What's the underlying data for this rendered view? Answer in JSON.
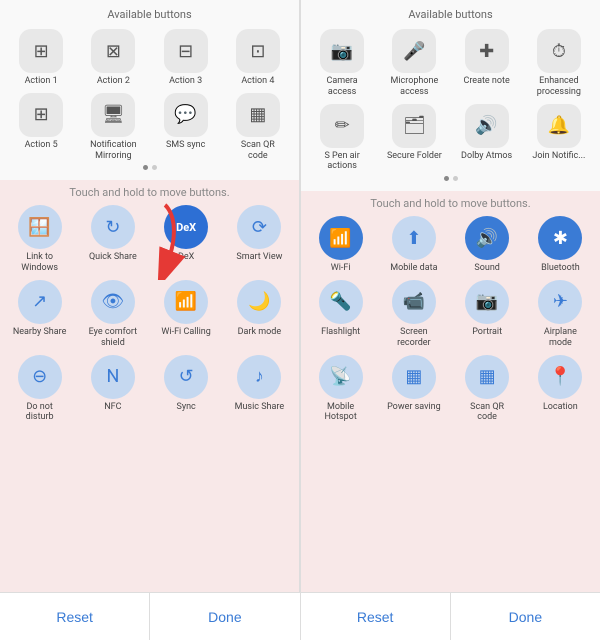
{
  "left_panel": {
    "available_title": "Available buttons",
    "available_buttons": [
      {
        "label": "Action 1",
        "icon": "⊞"
      },
      {
        "label": "Action 2",
        "icon": "⊠"
      },
      {
        "label": "Action 3",
        "icon": "⊟"
      },
      {
        "label": "Action 4",
        "icon": "⊡"
      },
      {
        "label": "Action 5",
        "icon": "⊞"
      },
      {
        "label": "Notification Mirroring",
        "icon": "🖥"
      },
      {
        "label": "SMS sync",
        "icon": "💬"
      },
      {
        "label": "Scan QR code",
        "icon": "▦"
      }
    ],
    "active_title": "Touch and hold to move buttons.",
    "active_buttons": [
      {
        "label": "Link to Windows",
        "icon": "🪟",
        "on": false
      },
      {
        "label": "Quick Share",
        "icon": "↻",
        "on": false
      },
      {
        "label": "DeX",
        "icon": "DeX",
        "on": true,
        "special": "dex"
      },
      {
        "label": "Smart View",
        "icon": "⟳",
        "on": false
      },
      {
        "label": "Nearby Share",
        "icon": "↗",
        "on": false
      },
      {
        "label": "Eye comfort shield",
        "icon": "👁",
        "on": false
      },
      {
        "label": "Wi-Fi Calling",
        "icon": "📶",
        "on": false
      },
      {
        "label": "Dark mode",
        "icon": "🌙",
        "on": false
      },
      {
        "label": "Do not disturb",
        "icon": "⊖",
        "on": false
      },
      {
        "label": "NFC",
        "icon": "N",
        "on": false
      },
      {
        "label": "Sync",
        "icon": "↺",
        "on": false
      },
      {
        "label": "Music Share",
        "icon": "♪",
        "on": false
      }
    ],
    "reset": "Reset",
    "done": "Done"
  },
  "right_panel": {
    "available_title": "Available buttons",
    "available_buttons": [
      {
        "label": "Camera access",
        "icon": "📷"
      },
      {
        "label": "Microphone access",
        "icon": "🎤"
      },
      {
        "label": "Create note",
        "icon": "✚"
      },
      {
        "label": "Enhanced processing",
        "icon": "⏱"
      },
      {
        "label": "S Pen air actions",
        "icon": "✏"
      },
      {
        "label": "Secure Folder",
        "icon": "🗂"
      },
      {
        "label": "Dolby Atmos",
        "icon": "🔊"
      },
      {
        "label": "Join Notific...",
        "icon": "🔔"
      }
    ],
    "active_title": "Touch and hold to move buttons.",
    "active_buttons": [
      {
        "label": "Wi-Fi",
        "icon": "📶",
        "on": true
      },
      {
        "label": "Mobile data",
        "icon": "⬆",
        "on": false
      },
      {
        "label": "Sound",
        "icon": "🔊",
        "on": true
      },
      {
        "label": "Bluetooth",
        "icon": "✱",
        "on": true
      },
      {
        "label": "Flashlight",
        "icon": "🔦",
        "on": false
      },
      {
        "label": "Screen recorder",
        "icon": "📹",
        "on": false
      },
      {
        "label": "Portrait",
        "icon": "📷",
        "on": false
      },
      {
        "label": "Airplane mode",
        "icon": "✈",
        "on": false
      },
      {
        "label": "Mobile Hotspot",
        "icon": "📡",
        "on": false
      },
      {
        "label": "Power saving",
        "icon": "▦",
        "on": false
      },
      {
        "label": "Scan QR code",
        "icon": "▦",
        "on": false
      },
      {
        "label": "Location",
        "icon": "📍",
        "on": false
      }
    ],
    "reset": "Reset",
    "done": "Done"
  }
}
